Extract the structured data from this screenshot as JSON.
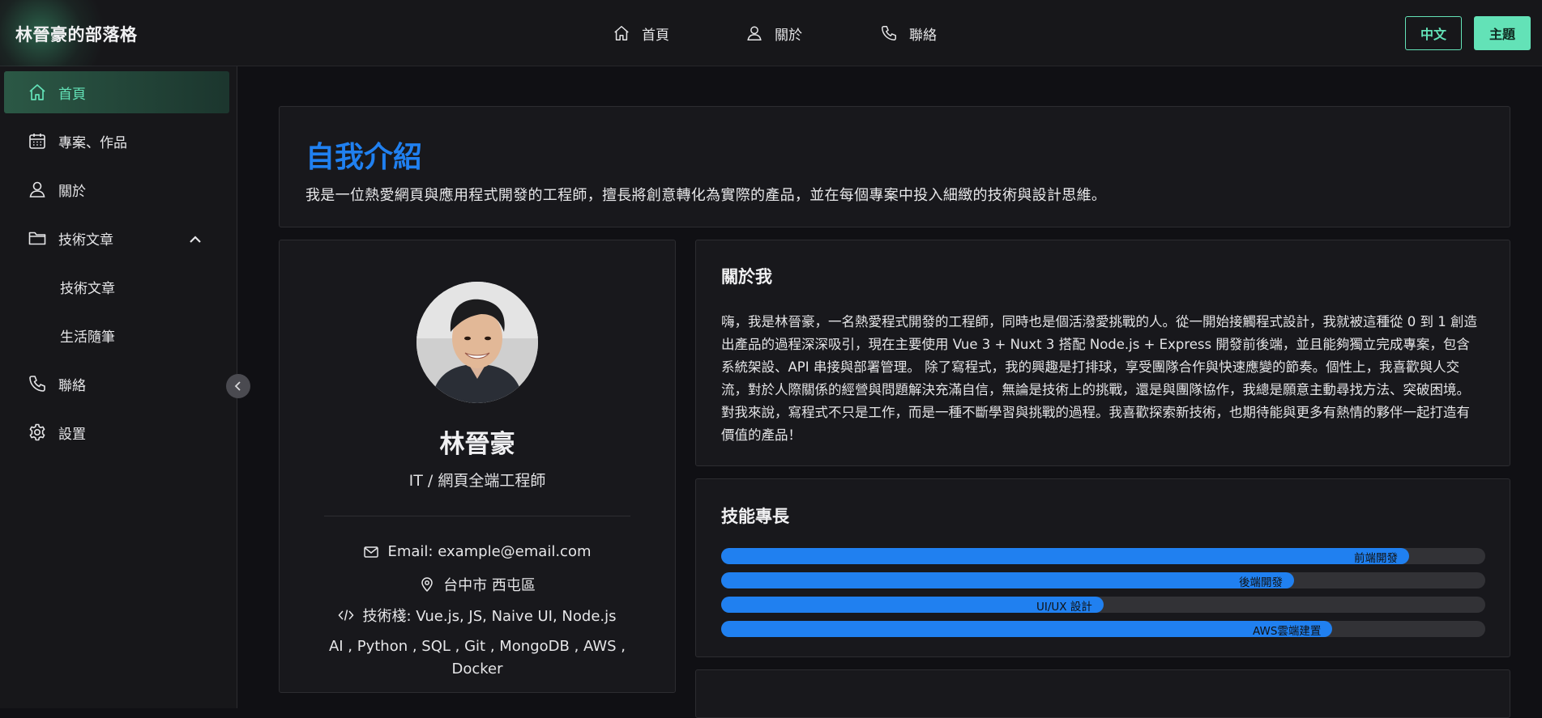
{
  "header": {
    "brand": "林晉豪的部落格",
    "nav": [
      {
        "label": "首頁",
        "icon": "home-icon"
      },
      {
        "label": "關於",
        "icon": "user-icon"
      },
      {
        "label": "聯絡",
        "icon": "phone-icon"
      }
    ],
    "lang_button": "中文",
    "theme_button": "主題",
    "accent_color": "#63e2b7"
  },
  "sidebar": {
    "items": [
      {
        "label": "首頁",
        "icon": "home-icon",
        "active": true
      },
      {
        "label": "專案、作品",
        "icon": "calendar-icon"
      },
      {
        "label": "關於",
        "icon": "user-icon"
      },
      {
        "label": "技術文章",
        "icon": "folder-icon",
        "expanded": true
      },
      {
        "label": "聯絡",
        "icon": "phone-icon"
      },
      {
        "label": "設置",
        "icon": "gear-icon"
      }
    ],
    "subitems": [
      {
        "label": "技術文章"
      },
      {
        "label": "生活隨筆"
      }
    ]
  },
  "intro": {
    "title": "自我介紹",
    "text": "我是一位熱愛網頁與應用程式開發的工程師，擅長將創意轉化為實際的產品，並在每個專案中投入細緻的技術與設計思維。",
    "title_color": "#2080f0"
  },
  "profile": {
    "name": "林晉豪",
    "role": "IT / 網頁全端工程師",
    "email": "Email: example@email.com",
    "location": "台中市 西屯區",
    "stack_line1": "技術棧: Vue.js, JS, Naive UI, Node.js",
    "stack_line2": "AI , Python , SQL , Git , MongoDB , AWS , Docker"
  },
  "about": {
    "title": "關於我",
    "text": "嗨，我是林晉豪，一名熱愛程式開發的工程師，同時也是個活潑愛挑戰的人。從一開始接觸程式設計，我就被這種從 0 到 1 創造出產品的過程深深吸引，現在主要使用 Vue 3 + Nuxt 3 搭配 Node.js + Express 開發前後端，並且能夠獨立完成專案，包含系統架設、API 串接與部署管理。 除了寫程式，我的興趣是打排球，享受團隊合作與快速應變的節奏。個性上，我喜歡與人交流，對於人際關係的經營與問題解決充滿自信，無論是技術上的挑戰，還是與團隊協作，我總是願意主動尋找方法、突破困境。 對我來說，寫程式不只是工作，而是一種不斷學習與挑戰的過程。我喜歡探索新技術，也期待能與更多有熱情的夥伴一起打造有價值的產品！"
  },
  "skills": {
    "title": "技能專長",
    "items": [
      {
        "label": "前端開發",
        "level": 0.9
      },
      {
        "label": "後端開發",
        "level": 0.75
      },
      {
        "label": "UI/UX 設計",
        "level": 0.5
      },
      {
        "label": "AWS雲端建置",
        "level": 0.8
      }
    ],
    "bar_color": "#2080f0"
  }
}
